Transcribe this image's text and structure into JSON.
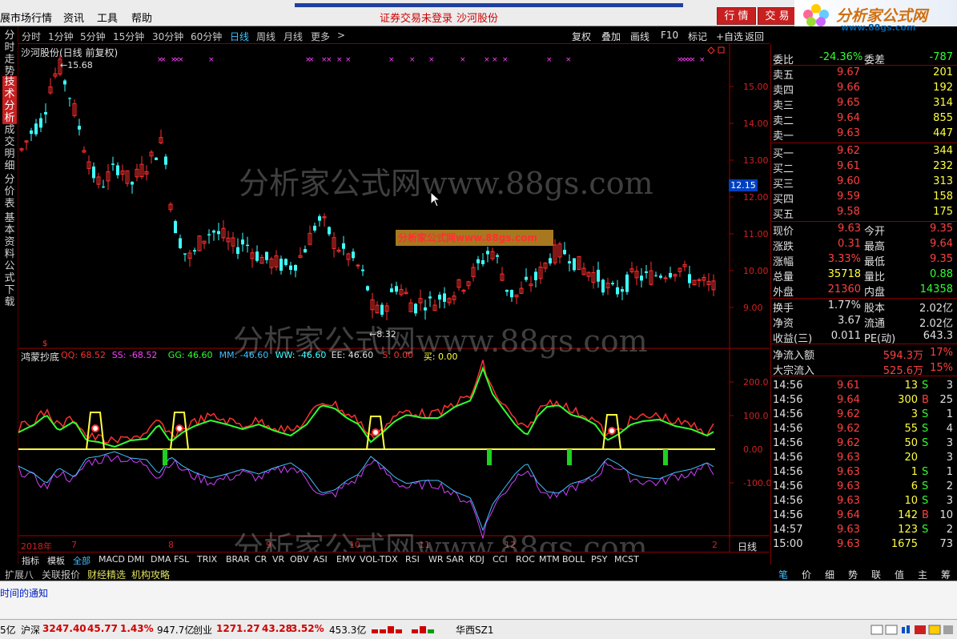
{
  "menu": {
    "items": [
      "展市场行情",
      "资讯",
      "工具",
      "帮助"
    ],
    "status_login": "证券交易未登录",
    "status_stock": "沙河股份",
    "btn_quote": "行 情",
    "btn_trade": "交 易"
  },
  "brand": {
    "name": "分析家公式网",
    "url": "www.88gs.com"
  },
  "left_tabs": [
    "分时走势",
    "技术分析",
    "成交明细",
    "分价表",
    "基本资料",
    "公式下载"
  ],
  "period_bar": {
    "periods": [
      "分时",
      "1分钟",
      "5分钟",
      "15分钟",
      "30分钟",
      "60分钟",
      "日线",
      "周线",
      "月线",
      "更多"
    ],
    "active": "日线",
    "tools": [
      "复权",
      "叠加",
      "画线",
      "F10",
      "标记",
      "+自选",
      "返回"
    ]
  },
  "chart": {
    "title": "沙河股份(日线 前复权)",
    "high_label": "15.68",
    "low_label": "8.32",
    "price_axis": [
      "15.00",
      "14.00",
      "13.00",
      "12.00",
      "11.00",
      "10.00",
      "9.00"
    ],
    "current_price": "12.15",
    "indicator_name": "鸿蒙抄底",
    "indicator_values": [
      {
        "label": "QQ: 68.52",
        "color": "#ff3030"
      },
      {
        "label": "SS: -68.52",
        "color": "#ff40ff"
      },
      {
        "label": "GG: 46.60",
        "color": "#30ff30"
      },
      {
        "label": "MM: -46.60",
        "color": "#40c0ff"
      },
      {
        "label": "WW: -46.60",
        "color": "#40ffff"
      },
      {
        "label": "EE: 46.60",
        "color": "#e0e0e0"
      },
      {
        "label": "S: 0.00",
        "color": "#ff3030"
      },
      {
        "label": "买: 0.00",
        "color": "#ffff40"
      }
    ],
    "ind_axis": [
      "200.0",
      "100.0",
      "0.00",
      "-100.0"
    ],
    "date_labels": [
      "2018年",
      "7",
      "8",
      "9",
      "10",
      "11",
      "12",
      "2"
    ],
    "period_label": "日线",
    "watermark": "分析家公式网www.88gs.com",
    "watermark_box": "分析家公式网www.88gs.com"
  },
  "indicator_tabs": [
    "指标",
    "模板",
    "全部",
    "MACD",
    "DMI",
    "DMA",
    "FSL",
    "TRIX",
    "BRAR",
    "CR",
    "VR",
    "OBV",
    "ASI",
    "EMV",
    "VOL-TDX",
    "RSI",
    "WR",
    "SAR",
    "KDJ",
    "CCI",
    "ROC",
    "MTM",
    "BOLL",
    "PSY",
    "MCST"
  ],
  "bottom_tabs": [
    {
      "label": "扩展八",
      "color": "#e0e0e0"
    },
    {
      "label": "关联报价",
      "color": "#e0e0e0"
    },
    {
      "label": "财经精选",
      "color": "#e0e060"
    },
    {
      "label": "机构攻略",
      "color": "#e0e060"
    }
  ],
  "quote": {
    "wei_bi": {
      "label": "委比",
      "value": "-24.36%",
      "diff_label": "委差",
      "diff": "-787"
    },
    "sell": [
      {
        "label": "卖五",
        "price": "9.67",
        "vol": "201"
      },
      {
        "label": "卖四",
        "price": "9.66",
        "vol": "192"
      },
      {
        "label": "卖三",
        "price": "9.65",
        "vol": "314"
      },
      {
        "label": "卖二",
        "price": "9.64",
        "vol": "855"
      },
      {
        "label": "卖一",
        "price": "9.63",
        "vol": "447"
      }
    ],
    "buy": [
      {
        "label": "买一",
        "price": "9.62",
        "vol": "344"
      },
      {
        "label": "买二",
        "price": "9.61",
        "vol": "232"
      },
      {
        "label": "买三",
        "price": "9.60",
        "vol": "313"
      },
      {
        "label": "买四",
        "price": "9.59",
        "vol": "158"
      },
      {
        "label": "买五",
        "price": "9.58",
        "vol": "175"
      }
    ],
    "stats": [
      {
        "l1": "现价",
        "v1": "9.63",
        "c1": "#ff4040",
        "l2": "今开",
        "v2": "9.35",
        "c2": "#ff4040"
      },
      {
        "l1": "涨跌",
        "v1": "0.31",
        "c1": "#ff4040",
        "l2": "最高",
        "v2": "9.64",
        "c2": "#ff4040"
      },
      {
        "l1": "涨幅",
        "v1": "3.33%",
        "c1": "#ff4040",
        "l2": "最低",
        "v2": "9.35",
        "c2": "#ff4040"
      },
      {
        "l1": "总量",
        "v1": "35718",
        "c1": "#ffff40",
        "l2": "量比",
        "v2": "0.88",
        "c2": "#30ff30"
      },
      {
        "l1": "外盘",
        "v1": "21360",
        "c1": "#ff4040",
        "l2": "内盘",
        "v2": "14358",
        "c2": "#30ff30"
      }
    ],
    "stats2": [
      {
        "l1": "换手",
        "v1": "1.77%",
        "l2": "股本",
        "v2": "2.02亿"
      },
      {
        "l1": "净资",
        "v1": "3.67",
        "l2": "流通",
        "v2": "2.02亿"
      },
      {
        "l1": "收益(三)",
        "v1": "0.011",
        "l2": "PE(动)",
        "v2": "643.3"
      }
    ],
    "flow": [
      {
        "label": "净流入额",
        "value": "594.3万",
        "pct": "17%"
      },
      {
        "label": "大宗流入",
        "value": "525.6万",
        "pct": "15%"
      }
    ],
    "ticks": [
      {
        "t": "14:56",
        "p": "9.61",
        "v": "13",
        "s": "S",
        "n": "3"
      },
      {
        "t": "14:56",
        "p": "9.64",
        "v": "300",
        "s": "B",
        "n": "25"
      },
      {
        "t": "14:56",
        "p": "9.62",
        "v": "3",
        "s": "S",
        "n": "1"
      },
      {
        "t": "14:56",
        "p": "9.62",
        "v": "55",
        "s": "S",
        "n": "4"
      },
      {
        "t": "14:56",
        "p": "9.62",
        "v": "50",
        "s": "S",
        "n": "3"
      },
      {
        "t": "14:56",
        "p": "9.63",
        "v": "20",
        "s": "",
        "n": "3"
      },
      {
        "t": "14:56",
        "p": "9.63",
        "v": "1",
        "s": "S",
        "n": "1"
      },
      {
        "t": "14:56",
        "p": "9.63",
        "v": "6",
        "s": "S",
        "n": "2"
      },
      {
        "t": "14:56",
        "p": "9.63",
        "v": "10",
        "s": "S",
        "n": "3"
      },
      {
        "t": "14:56",
        "p": "9.64",
        "v": "142",
        "s": "B",
        "n": "10"
      },
      {
        "t": "14:57",
        "p": "9.63",
        "v": "123",
        "s": "S",
        "n": "2"
      },
      {
        "t": "15:00",
        "p": "9.63",
        "v": "1675",
        "s": "",
        "n": "73"
      }
    ]
  },
  "right_tabs": [
    "笔",
    "价",
    "细",
    "势",
    "联",
    "值",
    "主",
    "筹"
  ],
  "notice": "时间的通知",
  "statusbar": {
    "prefix": "5亿",
    "sh": {
      "name": "沪深",
      "v": "3247.40",
      "c": "45.77",
      "p": "1.43%",
      "amt": "947.7亿"
    },
    "cy": {
      "name": "创业",
      "v": "1271.27",
      "c": "43.28",
      "p": "3.52%",
      "amt": "453.3亿"
    },
    "ticker": "华西SZ1"
  }
}
